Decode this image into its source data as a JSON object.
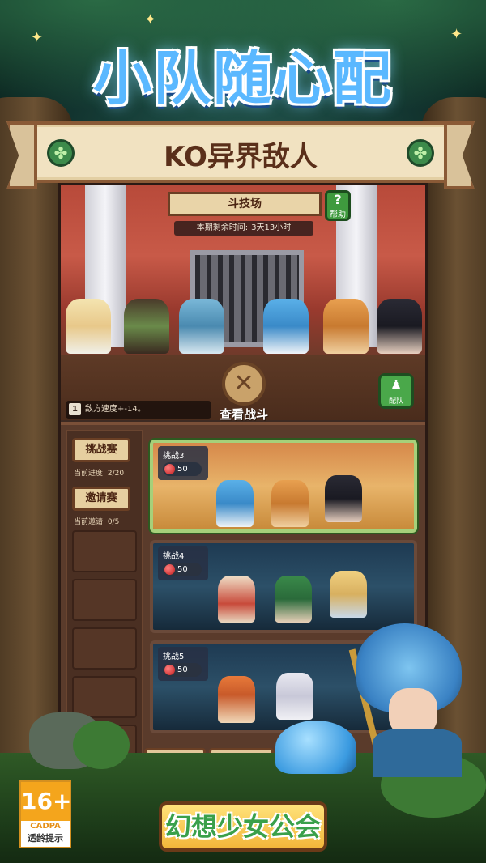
{
  "promo": {
    "headline": "小队随心配",
    "banner": "KO异界敌人"
  },
  "arena": {
    "title": "斗技场",
    "help_label": "帮助",
    "help_glyph": "?",
    "timer_label": "本期剩余时间:",
    "timer_value": "3天13小时",
    "buff_number": "1",
    "buff_text": "敌方速度+-14。",
    "watch_label": "查看战斗",
    "team_label": "配队"
  },
  "sidebar": {
    "challenge_button": "挑战赛",
    "challenge_progress": "当前进度: 2/20",
    "invite_button": "邀请赛",
    "invite_progress": "当前邀请: 0/5"
  },
  "challenges": [
    {
      "name": "挑战3",
      "cost": "50",
      "active": true
    },
    {
      "name": "挑战4",
      "cost": "50",
      "active": false
    },
    {
      "name": "挑战5",
      "cost": "50",
      "active": false
    }
  ],
  "rating": {
    "age": "16+",
    "org": "CADPA",
    "tip": "适龄提示"
  },
  "logo": {
    "text": "幻想少女公会"
  },
  "icons": {
    "clover_left": "clover-icon",
    "clover_right": "clover-icon",
    "swords": "crossed-swords-icon",
    "team": "team-icon",
    "orb": "red-gem-icon"
  },
  "colors": {
    "headline": "#5ab8ff",
    "banner_bg": "#f1e2c1",
    "active_card_border": "#a6d07a",
    "rating_orange": "#f4a51c"
  }
}
